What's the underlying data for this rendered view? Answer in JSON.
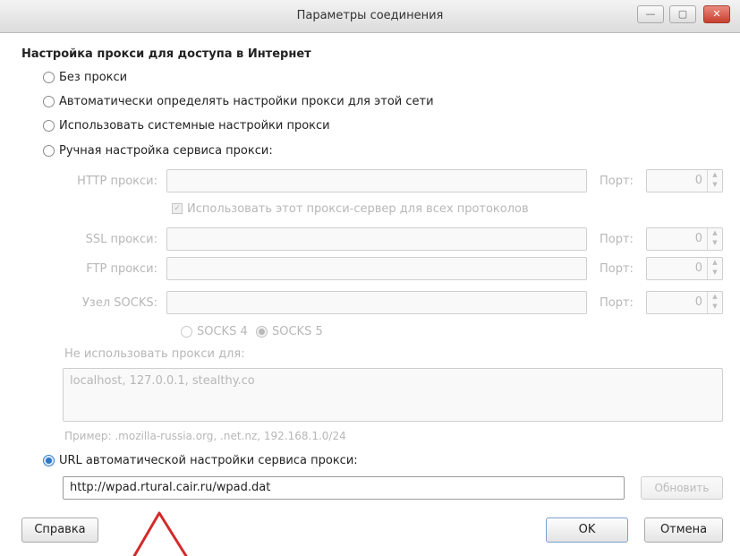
{
  "window": {
    "title": "Параметры соединения",
    "minimize_symbol": "—",
    "maximize_symbol": "▢",
    "close_symbol": "✕"
  },
  "section_title": "Настройка прокси для доступа в Интернет",
  "options": {
    "no_proxy": "Без прокси",
    "auto_detect": "Автоматически определять настройки прокси для этой сети",
    "system": "Использовать системные настройки прокси",
    "manual": "Ручная настройка сервиса прокси:",
    "pac_url": "URL автоматической настройки сервиса прокси:"
  },
  "selected_option": "pac_url",
  "manual": {
    "http_label": "HTTP прокси:",
    "ssl_label": "SSL прокси:",
    "ftp_label": "FTP прокси:",
    "socks_label": "Узел SOCKS:",
    "port_label": "Порт:",
    "port_value": "0",
    "use_for_all": "Использовать этот прокси-сервер для всех протоколов",
    "use_for_all_checked": true,
    "socks4": "SOCKS 4",
    "socks5": "SOCKS 5",
    "socks_selected": "SOCKS 5",
    "no_proxy_for_label": "Не использовать прокси для:",
    "no_proxy_for_value": "localhost, 127.0.0.1, stealthy.co",
    "example": "Пример: .mozilla-russia.org, .net.nz, 192.168.1.0/24"
  },
  "pac": {
    "url_value": "http://wpad.rtural.cair.ru/wpad.dat",
    "reload_button": "Обновить"
  },
  "buttons": {
    "help": "Справка",
    "ok": "OK",
    "cancel": "Отмена"
  },
  "colors": {
    "annotation_arrow": "#d42a2a",
    "radio_accent": "#2e77c8"
  }
}
